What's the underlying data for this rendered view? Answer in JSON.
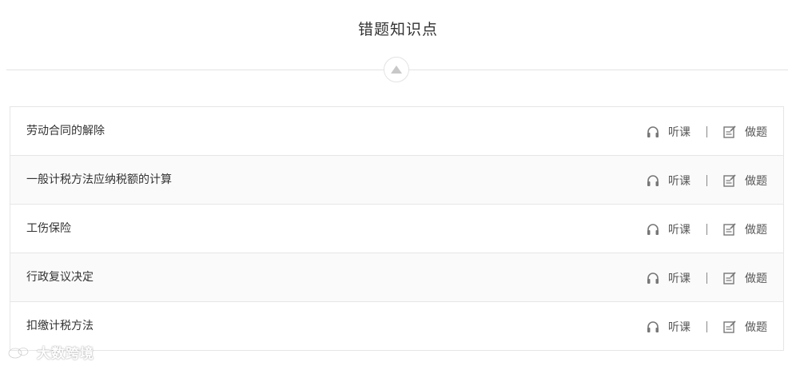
{
  "header": {
    "title": "错题知识点"
  },
  "actions": {
    "listen_label": "听课",
    "practice_label": "做题",
    "listen_icon": "headphones-icon",
    "practice_icon": "edit-note-icon"
  },
  "items": [
    {
      "title": "劳动合同的解除"
    },
    {
      "title": "一般计税方法应纳税额的计算"
    },
    {
      "title": "工伤保险"
    },
    {
      "title": "行政复议决定"
    },
    {
      "title": "扣缴计税方法"
    }
  ],
  "watermark": {
    "text": "大数跨境"
  },
  "colors": {
    "border": "#e6e6e6",
    "text": "#333333",
    "alt_row": "#fafafa"
  }
}
